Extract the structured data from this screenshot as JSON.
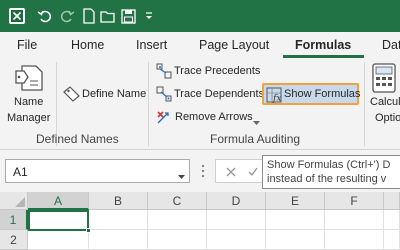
{
  "quick_access": {
    "icons": [
      "excel-logo-icon",
      "undo-icon",
      "redo-icon",
      "new-file-icon",
      "open-folder-icon",
      "save-icon",
      "customize-icon"
    ]
  },
  "tabs": [
    {
      "label": "File"
    },
    {
      "label": "Home"
    },
    {
      "label": "Insert"
    },
    {
      "label": "Page Layout"
    },
    {
      "label": "Formulas",
      "active": true
    },
    {
      "label": "Dat"
    }
  ],
  "ribbon": {
    "defined_names": {
      "name_manager": "Name\nManager",
      "name_manager_line1": "Name",
      "name_manager_line2": "Manager",
      "define_name": "Define Name",
      "group_label": "Defined Names"
    },
    "formula_auditing": {
      "trace_precedents": "Trace Precedents",
      "trace_dependents": "Trace Dependents",
      "remove_arrows": "Remove Arrows",
      "show_formulas": "Show Formulas",
      "group_label": "Formula Auditing"
    },
    "calculation": {
      "line1": "Calcula",
      "line2": "Optio"
    }
  },
  "formula_bar": {
    "name_box": "A1",
    "formula_value": ""
  },
  "tooltip": {
    "line1": "Show Formulas (Ctrl+') D",
    "line2": "instead of the resulting v"
  },
  "grid": {
    "columns": [
      "A",
      "B",
      "C",
      "D",
      "E",
      "F"
    ],
    "rows": [
      "1",
      "2"
    ],
    "selected_cell": "A1"
  },
  "colors": {
    "accent": "#217346",
    "highlight_border": "#f3a13c",
    "highlight_fill": "#c9d9ec"
  }
}
